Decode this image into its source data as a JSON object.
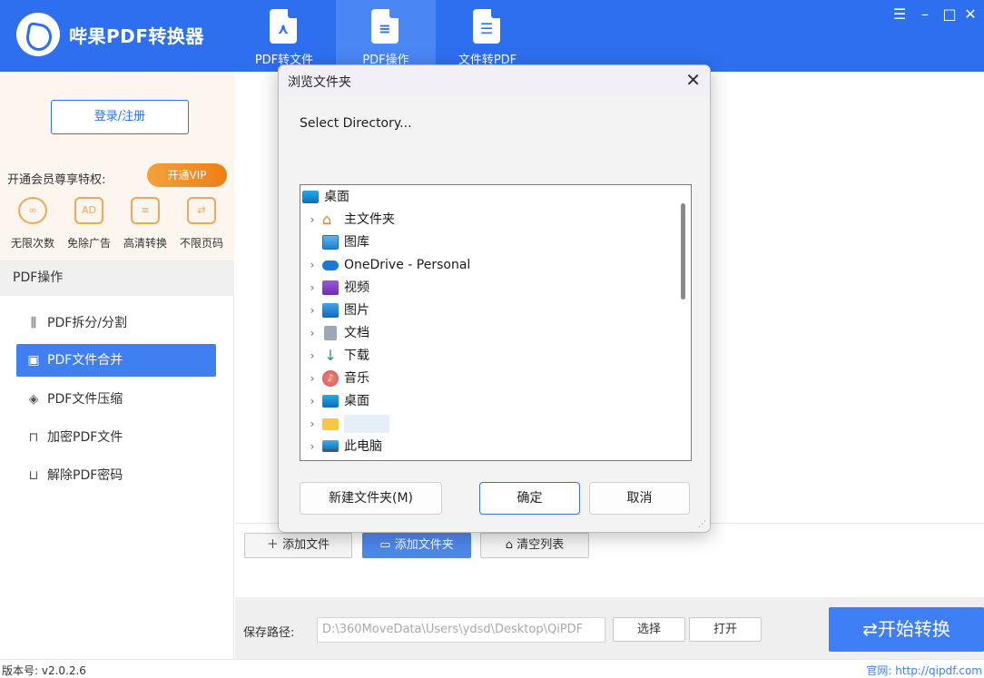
{
  "app": {
    "title": "哔果PDF转换器"
  },
  "nav": {
    "tabs": [
      {
        "label": "PDF转文件",
        "icon": "pdf-acrobat-icon"
      },
      {
        "label": "PDF操作",
        "icon": "pdf-tools-icon",
        "active": true
      },
      {
        "label": "文件转PDF",
        "icon": "file-to-pdf-icon"
      }
    ]
  },
  "window_controls": [
    "menu-icon",
    "minimize-icon",
    "maximize-icon",
    "close-icon"
  ],
  "sidebar": {
    "login_label": "登录/注册",
    "member_tip": "开通会员尊享特权:",
    "vip_label": "开通VIP",
    "perks": [
      "无限次数",
      "免除广告",
      "高清转换",
      "不限页码"
    ],
    "section_title": "PDF操作",
    "menu": [
      {
        "label": "PDF拆分/分割",
        "icon": "split-icon"
      },
      {
        "label": "PDF文件合并",
        "icon": "merge-icon",
        "active": true
      },
      {
        "label": "PDF文件压缩",
        "icon": "compress-icon"
      },
      {
        "label": "加密PDF文件",
        "icon": "lock-icon"
      },
      {
        "label": "解除PDF密码",
        "icon": "unlock-icon"
      }
    ]
  },
  "toolbar": {
    "add_file": "添加文件",
    "add_folder": "添加文件夹",
    "clear_list": "清空列表"
  },
  "bottom": {
    "save_label": "保存路径:",
    "save_path": "D:\\360MoveData\\Users\\ydsd\\Desktop\\QiPDF",
    "choose": "选择",
    "open": "打开",
    "start": "⇄开始转换"
  },
  "status": {
    "version": "版本号: v2.0.2.6",
    "website": "官网: http://qipdf.com"
  },
  "dialog": {
    "title": "浏览文件夹",
    "prompt": "Select Directory...",
    "tree": [
      {
        "label": "桌面",
        "icon": "desktop-icon",
        "expandable": false,
        "root": true
      },
      {
        "label": "主文件夹",
        "icon": "home-icon",
        "expandable": true
      },
      {
        "label": "图库",
        "icon": "gallery-icon",
        "expandable": false
      },
      {
        "label": "OneDrive - Personal",
        "icon": "onedrive-cloud-icon",
        "expandable": true
      },
      {
        "label": "视频",
        "icon": "video-icon",
        "expandable": true
      },
      {
        "label": "图片",
        "icon": "pictures-icon",
        "expandable": true
      },
      {
        "label": "文档",
        "icon": "documents-icon",
        "expandable": true
      },
      {
        "label": "下载",
        "icon": "download-icon",
        "expandable": true
      },
      {
        "label": "音乐",
        "icon": "music-icon",
        "expandable": true
      },
      {
        "label": "桌面",
        "icon": "desktop-icon",
        "expandable": true
      },
      {
        "label": "",
        "icon": "folder-icon",
        "expandable": true
      },
      {
        "label": "此电脑",
        "icon": "computer-icon",
        "expandable": true
      }
    ],
    "new_folder": "新建文件夹(M)",
    "ok": "确定",
    "cancel": "取消"
  },
  "colors": {
    "brand_blue": "#2e6ff0",
    "accent_orange": "#ef7e12",
    "active_menu": "#3f7ff2"
  }
}
